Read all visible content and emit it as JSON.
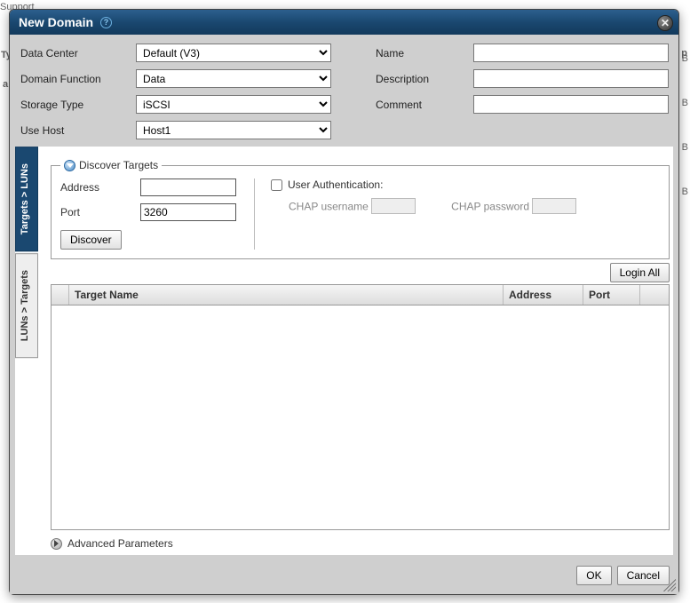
{
  "background": {
    "support": "Support",
    "ty": "Ty",
    "a": "a",
    "p": "p",
    "b": "B"
  },
  "dialog": {
    "title": "New Domain",
    "help_glyph": "?",
    "close_glyph": "✕"
  },
  "form": {
    "data_center": {
      "label": "Data Center",
      "value": "Default (V3)"
    },
    "domain_function": {
      "label": "Domain Function",
      "value": "Data"
    },
    "storage_type": {
      "label": "Storage Type",
      "value": "iSCSI"
    },
    "use_host": {
      "label": "Use Host",
      "value": "Host1"
    },
    "name": {
      "label": "Name",
      "value": ""
    },
    "description": {
      "label": "Description",
      "value": ""
    },
    "comment": {
      "label": "Comment",
      "value": ""
    }
  },
  "tabs": {
    "targets_luns": "Targets > LUNs",
    "luns_targets": "LUNs > Targets"
  },
  "discover": {
    "legend": "Discover Targets",
    "address_label": "Address",
    "address_value": "",
    "port_label": "Port",
    "port_value": "3260",
    "discover_btn": "Discover",
    "user_auth_label": "User Authentication:",
    "user_auth_checked": false,
    "chap_user_label": "CHAP username",
    "chap_user_value": "",
    "chap_pass_label": "CHAP password",
    "chap_pass_value": ""
  },
  "login_all": "Login All",
  "table": {
    "col_target": "Target Name",
    "col_address": "Address",
    "col_port": "Port",
    "rows": []
  },
  "advanced": "Advanced Parameters",
  "buttons": {
    "ok": "OK",
    "cancel": "Cancel"
  }
}
